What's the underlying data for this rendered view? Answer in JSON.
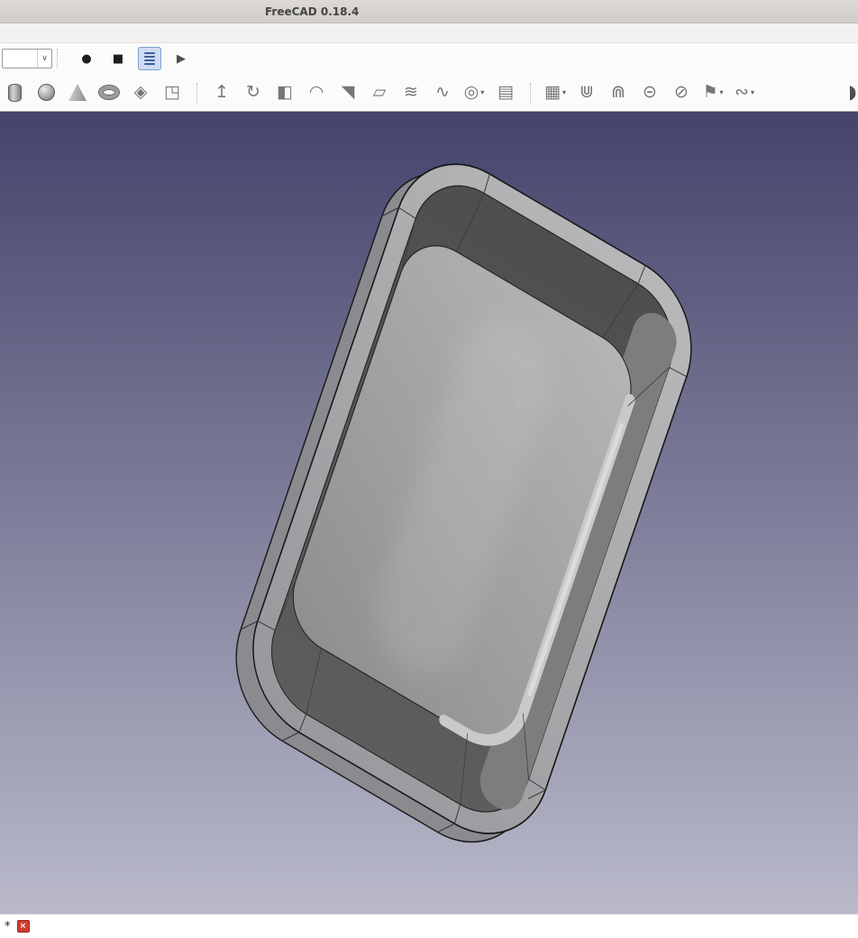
{
  "window": {
    "title": "FreeCAD 0.18.4"
  },
  "macro_toolbar": {
    "combo_value": "",
    "combo_arrow_glyph": "∨",
    "buttons": [
      {
        "name": "macro-record-button",
        "icon": "record-icon",
        "glyph": "●",
        "color": "#1e1e1e"
      },
      {
        "name": "macro-stop-button",
        "icon": "stop-icon",
        "glyph": "■",
        "color": "#1e1e1e"
      },
      {
        "name": "macro-dialog-button",
        "icon": "macro-lines-icon",
        "style": "bars",
        "active": true
      },
      {
        "name": "macro-play-button",
        "icon": "play-icon",
        "glyph": "▶",
        "color": "#4d4d4d"
      }
    ]
  },
  "part_toolbar": {
    "dropdown_glyph": "▾",
    "items": [
      {
        "type": "icon",
        "name": "cylinder-icon",
        "shape": "cylinder"
      },
      {
        "type": "icon",
        "name": "sphere-icon",
        "shape": "sphere"
      },
      {
        "type": "icon",
        "name": "cone-icon",
        "shape": "cone"
      },
      {
        "type": "icon",
        "name": "torus-icon",
        "shape": "torus"
      },
      {
        "type": "icon",
        "name": "primitives-icon",
        "glyph": "◈"
      },
      {
        "type": "icon",
        "name": "shape-builder-icon",
        "glyph": "◳"
      },
      {
        "type": "sep"
      },
      {
        "type": "icon",
        "name": "extrude-icon",
        "glyph": "↥"
      },
      {
        "type": "icon",
        "name": "revolve-icon",
        "glyph": "↻"
      },
      {
        "type": "icon",
        "name": "mirror-icon",
        "glyph": "◧"
      },
      {
        "type": "icon",
        "name": "fillet-icon",
        "glyph": "◠"
      },
      {
        "type": "icon",
        "name": "chamfer-icon",
        "glyph": "◥"
      },
      {
        "type": "icon",
        "name": "ruled-surface-icon",
        "glyph": "▱"
      },
      {
        "type": "icon",
        "name": "loft-icon",
        "glyph": "≋"
      },
      {
        "type": "icon",
        "name": "sweep-icon",
        "glyph": "∿"
      },
      {
        "type": "icon",
        "name": "offset-icon",
        "glyph": "◎",
        "dropdown": true
      },
      {
        "type": "icon",
        "name": "thickness-icon",
        "glyph": "▤"
      },
      {
        "type": "sep"
      },
      {
        "type": "icon",
        "name": "compound-icon",
        "glyph": "▦",
        "dropdown": true
      },
      {
        "type": "icon",
        "name": "boolean-union-icon",
        "glyph": "⋓"
      },
      {
        "type": "icon",
        "name": "boolean-common-icon",
        "glyph": "⋒"
      },
      {
        "type": "icon",
        "name": "boolean-cut-icon",
        "glyph": "⊝"
      },
      {
        "type": "icon",
        "name": "section-icon",
        "glyph": "⊘"
      },
      {
        "type": "icon",
        "name": "cross-sections-icon",
        "glyph": "⚑",
        "dropdown": true
      },
      {
        "type": "icon",
        "name": "join-icon",
        "glyph": "∾",
        "dropdown": true
      },
      {
        "type": "icon",
        "name": "clipped-edge-icon",
        "glyph": "◗",
        "clipped": true
      }
    ]
  },
  "viewport": {
    "bg_top": "#44446c",
    "bg_bottom": "#b9b9ca",
    "model_light": "#b9b9bb",
    "model_dark": "#97979b",
    "face_light": "#b6b6b6",
    "face_dark": "#8e8e90",
    "interior_dark": "#4e4e4e",
    "interior_mid": "#5d5d5d",
    "wall_side": "#8a8a8f"
  },
  "bottom_bar": {
    "indicator": "*",
    "close_glyph": "×",
    "close_bg": "#cf3e30"
  }
}
